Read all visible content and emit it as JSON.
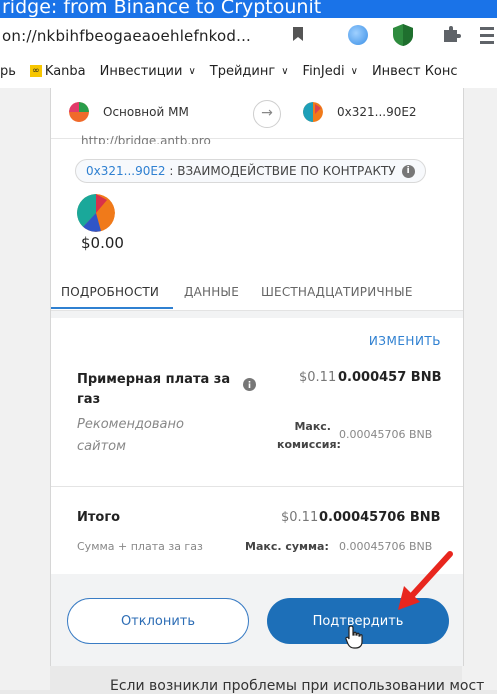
{
  "video_title": "ridge: from Binance to Cryptounit",
  "browser": {
    "url": "on://nkbihfbeogaeaoehlefnkod...",
    "bookmarks": [
      {
        "label": "рь",
        "has_chevron": false
      },
      {
        "label": "Kanba",
        "has_chevron": false,
        "icon": "kanban-icon"
      },
      {
        "label": "Инвестиции",
        "has_chevron": true
      },
      {
        "label": "Трейдинг",
        "has_chevron": true
      },
      {
        "label": "FinJedi",
        "has_chevron": true
      },
      {
        "label": "Инвест Конс",
        "has_chevron": false
      }
    ]
  },
  "wallet": {
    "from_account": "Основной ММ",
    "to_account": "0x321...90E2",
    "origin": "http://bridge.antb.pro",
    "contract": {
      "address": "0x321...90E2",
      "separator": " : ",
      "action": "ВЗАИМОДЕЙСТВИЕ ПО КОНТРАКТУ"
    },
    "amount": "$0.00",
    "tabs": [
      "ПОДРОБНОСТИ",
      "ДАННЫЕ",
      "ШЕСТНАДЦАТИРИЧНЫЕ"
    ],
    "active_tab": 0,
    "edit_label": "ИЗМЕНИТЬ",
    "gas": {
      "label": "Примерная плата за газ",
      "usd": "$0.11",
      "bnb": "0.000457 BNB",
      "recommended": "Рекомендовано сайтом",
      "max_fee_label": "Макс. комиссия:",
      "max_fee_value": "0.00045706 BNB"
    },
    "total": {
      "label": "Итого",
      "usd": "$0.11",
      "bnb": "0.00045706 BNB",
      "sub_label": "Сумма + плата за газ",
      "max_sum_label": "Макс. сумма:",
      "max_sum_value": "0.00045706 BNB"
    },
    "reject_label": "Отклонить",
    "confirm_label": "Подтвердить"
  },
  "bottom_text": "Если возникли проблемы при использовании мост",
  "colors": {
    "accent": "#2f80d1",
    "confirm_bg": "#1d6fb8",
    "annotation_arrow": "#e8261e"
  }
}
